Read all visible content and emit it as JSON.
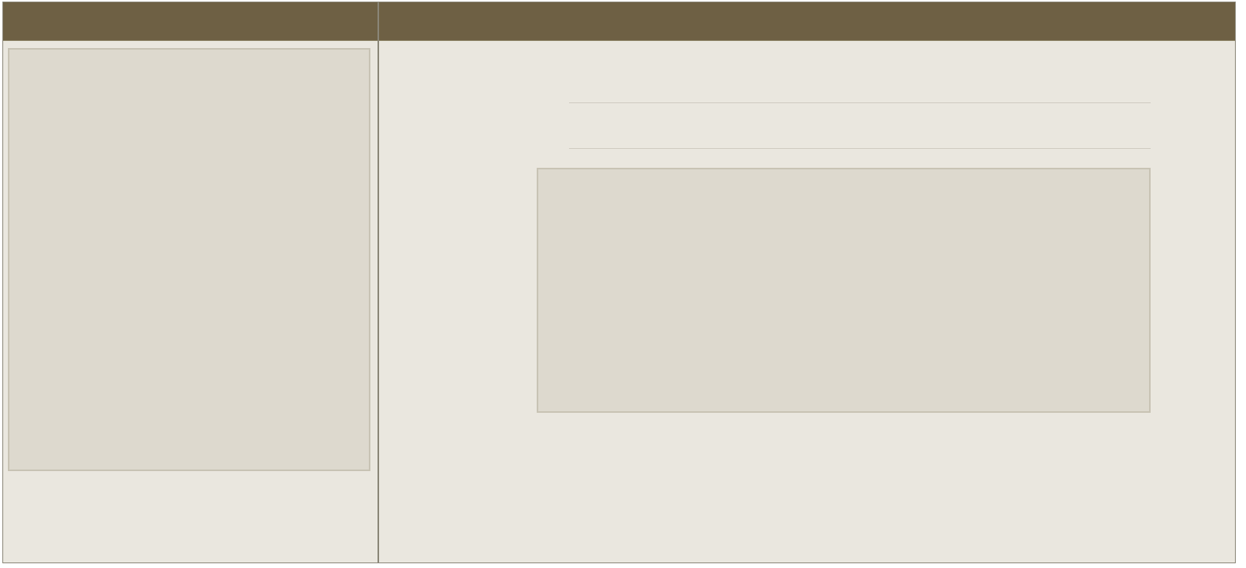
{
  "left_pane": {
    "title": "",
    "content_text": ""
  },
  "right_pane": {
    "title": "",
    "field_text": "",
    "content_text": ""
  },
  "colors": {
    "titlebar": "#6e6044",
    "pane_background": "#eae7df",
    "panel_background": "#ddd9ce",
    "panel_border": "#c8c3b4",
    "divider": "#cfcbc1"
  }
}
